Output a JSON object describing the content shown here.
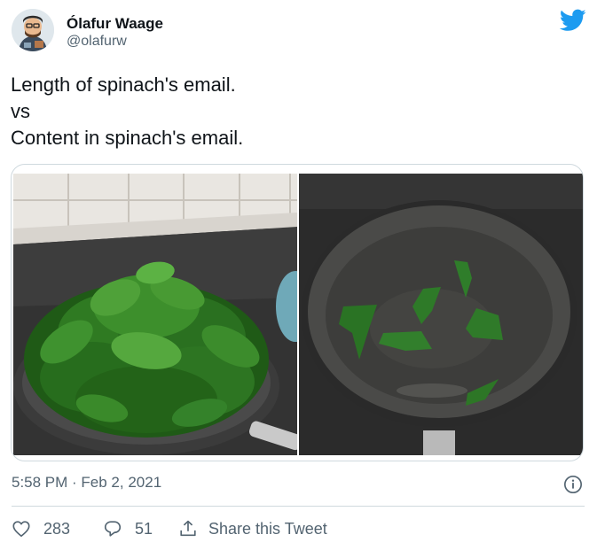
{
  "author": {
    "display_name": "Ólafur Waage",
    "handle": "@olafurw",
    "avatar_icon": "avatar-illustration"
  },
  "brand": {
    "icon": "twitter-bird-icon",
    "color": "#1d9bf0"
  },
  "tweet": {
    "lines": [
      "Length of spinach's email.",
      "vs",
      "Content in spinach's email."
    ]
  },
  "media": {
    "left_photo": "pile-of-spinach-in-pan",
    "right_photo": "few-cooked-spinach-leaves-in-pan"
  },
  "meta": {
    "timestamp": "5:58 PM · Feb 2, 2021",
    "info_icon": "info-icon"
  },
  "actions": {
    "like_count": "283",
    "reply_count": "51",
    "share_label": "Share this Tweet"
  },
  "colors": {
    "text": "#0f1419",
    "muted": "#536471",
    "border": "#cfd9de"
  }
}
